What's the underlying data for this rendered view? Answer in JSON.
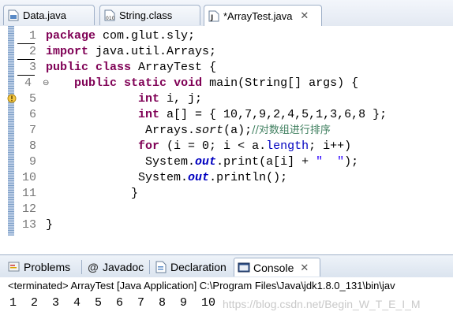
{
  "editor_tabs": [
    {
      "label": "Data.java",
      "icon": "java-file-icon"
    },
    {
      "label": "String.class",
      "icon": "class-file-icon"
    },
    {
      "label": "*ArrayTest.java",
      "icon": "java-file-icon",
      "active": true
    }
  ],
  "line_numbers": [
    "1",
    "2",
    "3",
    "4",
    "5",
    "6",
    "7",
    "8",
    "9",
    "10",
    "11",
    "12",
    "13"
  ],
  "code": {
    "l1": {
      "kw": "package",
      "rest": " com.glut.sly;"
    },
    "l2": {
      "kw": "import",
      "rest": " java.util.Arrays;"
    },
    "l3": {
      "kw1": "public",
      "kw2": "class",
      "rest": " ArrayTest {"
    },
    "l4": {
      "indent": "    ",
      "kw1": "public",
      "kw2": "static",
      "kw3": "void",
      "rest": " main(String[] args) {"
    },
    "l5": {
      "indent": "             ",
      "kw": "int",
      "rest": " i, j;"
    },
    "l6": {
      "indent": "             ",
      "kw": "int",
      "rest": " a[] = { 10,7,9,2,4,5,1,3,6,8 };"
    },
    "l7": {
      "indent": "              ",
      "pre": "Arrays.",
      "method": "sort",
      "post": "(a);",
      "comment": "//对数组进行排序"
    },
    "l8": {
      "indent": "             ",
      "kw": "for",
      "pre": " (i = 0; i < a.",
      "field": "length",
      "post": "; i++)"
    },
    "l9": {
      "indent": "              ",
      "pre": "System.",
      "field": "out",
      "post": ".print(a[i] + ",
      "str": "\"  \"",
      "end": ");"
    },
    "l10": {
      "indent": "             ",
      "pre": "System.",
      "field": "out",
      "post": ".println();"
    },
    "l11": {
      "indent": "            ",
      "text": "}"
    },
    "l13": {
      "text": "}"
    }
  },
  "view_tabs": [
    {
      "label": "Problems",
      "icon": "problems-icon"
    },
    {
      "label": "Javadoc",
      "icon": "at-icon"
    },
    {
      "label": "Declaration",
      "icon": "declaration-icon"
    },
    {
      "label": "Console",
      "icon": "console-icon",
      "active": true
    }
  ],
  "console": {
    "terminated": "<terminated> ArrayTest [Java Application] C:\\Program Files\\Java\\jdk1.8.0_131\\bin\\jav",
    "output": "1  2  3  4  5  6  7  8  9  10",
    "watermark": "https://blog.csdn.net/Begin_W_T_E_I_M"
  },
  "colors": {
    "keyword": "#7f0055",
    "field": "#0000c0",
    "comment": "#3f7f5f",
    "string": "#2a00ff"
  }
}
